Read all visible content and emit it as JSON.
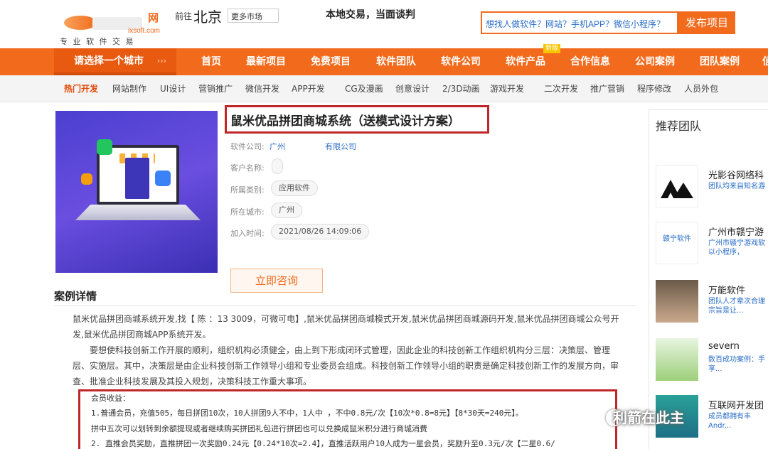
{
  "header": {
    "logo_wm": "网",
    "logo_site": "ixsoft.com",
    "logo_slogan": "专 业 软 件 交 易",
    "goto_label": "前往",
    "city": "北京",
    "more_market": "更多市场",
    "tagline": "本地交易，当面谈判",
    "search_placeholder": "想找人做软件？网站？手机APP？微信小程序？",
    "publish_button": "发布项目"
  },
  "nav": {
    "city_select": "请选择一个城市",
    "city_select_arrow": "›››",
    "items": [
      "首页",
      "最新项目",
      "免费项目",
      "软件团队",
      "软件公司",
      "软件产品",
      "合作信息",
      "公司案例",
      "团队案例",
      "信"
    ],
    "new_badge": "新版"
  },
  "subnav": {
    "items": [
      "热门开发",
      "网站制作",
      "UI设计",
      "营销推广",
      "微信开发",
      "APP开发",
      "CG及漫画",
      "创意设计",
      "2/3D动画",
      "游戏开发",
      "二次开发",
      "推广营销",
      "程序修改",
      "人员外包"
    ]
  },
  "product": {
    "title": "鼠米优品拼团商城系统（送模式设计方案）",
    "company_label": "软件公司:",
    "company_value": "广州                有限公司",
    "client_label": "客户名称:",
    "category_label": "所属类别:",
    "category_value": "应用软件",
    "city_label": "所在城市:",
    "city_value": "广州",
    "time_label": "加入时间:",
    "time_value": "2021/08/26 14:09:06",
    "consult_button": "立即咨询"
  },
  "detail": {
    "section_title": "案例详情",
    "p1": "鼠米优品拼团商城系统开发,找【 陈  ：13             3009，可微可电】,鼠米优品拼团商城模式开发,鼠米优品拼团商城源码开发,鼠米优品拼团商城公众号开发,鼠米优品拼团商城APP系统开发。",
    "p2": "要想使科技创新工作开展的顺利，组织机构必须健全，由上到下形成闭环式管理，因此企业的科技创新工作组织机构分三层：决策层、管理层、实施层。其中，决策层是由企业科技创新工作领导小组和专业委员会组成。科技创新工作领导小组的职责是确定科技创新工作的发展方向，审查、批准企业科技发展及其投入规划，决策科技工作重大事项。",
    "m0": "会员收益：",
    "m1": "1.普通会员，充值505，每日拼团10次，10人拼团9人不中，1人中 ，不中0.8元/次【10次*0.8=8元】【8*30天=240元】。",
    "m2": "拼中五次可以划转到余额提现或者继续购买拼团礼包进行拼团也可以兑换成鼠米积分进行商城消费",
    "m3": "2. 直推会员奖励，直推拼团一次奖励0.24元【0.24*10次=2.4】，直推活跃用户10人成为一星会员，奖励升至0.3元/次【二星0.6/"
  },
  "sidebar": {
    "title": "推荐团队",
    "teams": [
      {
        "name": "光影谷网络科",
        "desc": "团队均来自知名游"
      },
      {
        "name": "广州市赣宁游",
        "desc": "广州市赣宁游戏软以小程序，",
        "avatar_text": "赣宁软件"
      },
      {
        "name": "万能软件",
        "desc": "团队人才辈次合理宗旨是让..."
      },
      {
        "name": "severn",
        "desc": "数百成功案例：手享..."
      },
      {
        "name": "互联网开发团",
        "desc": "成员都拥有丰Andr..."
      }
    ]
  },
  "watermark": "利箭在此主"
}
